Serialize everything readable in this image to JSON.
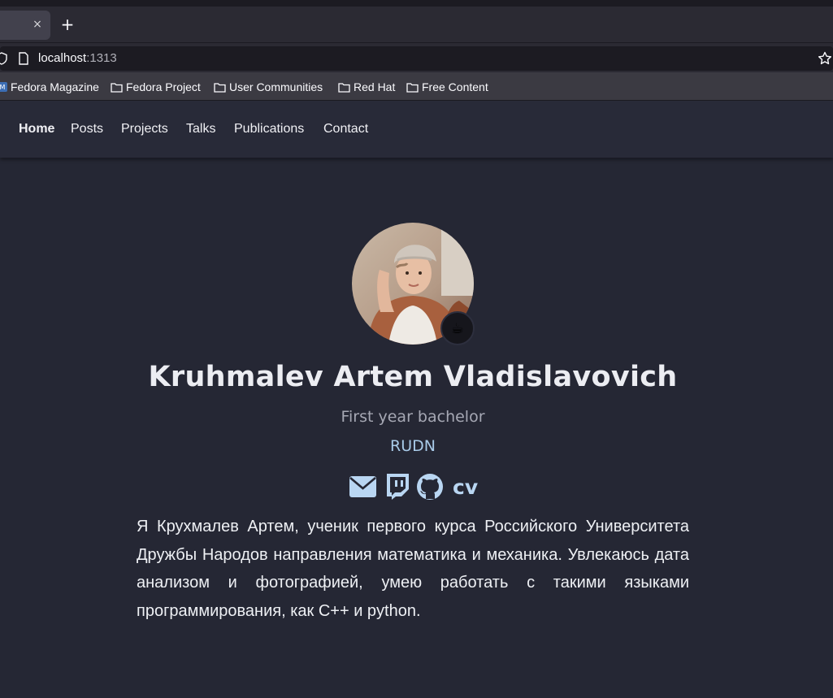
{
  "browser": {
    "tab_close": "×",
    "new_tab": "+",
    "url_host": "localhost",
    "url_port": ":1313",
    "bookmarks": [
      {
        "label": "Fedora Magazine",
        "icon": "fedora-magazine-icon"
      },
      {
        "label": "Fedora Project",
        "icon": "folder-icon"
      },
      {
        "label": "User Communities",
        "icon": "folder-icon"
      },
      {
        "label": "Red Hat",
        "icon": "folder-icon"
      },
      {
        "label": "Free Content",
        "icon": "folder-icon"
      }
    ]
  },
  "site_nav": {
    "items": [
      "Home",
      "Posts",
      "Projects",
      "Talks",
      "Publications",
      "Contact"
    ],
    "active": "Home"
  },
  "profile": {
    "badge_emoji": "☕",
    "name": "Kruhmalev Artem Vladislavovich",
    "role": "First year bachelor",
    "organization": "RUDN",
    "socials": [
      "envelope-icon",
      "twitch-icon",
      "github-icon"
    ],
    "cv_label": "cv",
    "bio": "Я Крухмалев Артем, ученик первого курса Российского Университета Дружбы Народов направления математика и механика. Увлекаюсь дата анализом и фотографией, умею работать с такими языками программирования, как C++ и python."
  },
  "colors": {
    "page_bg": "#252734",
    "nav_bg": "#282a38",
    "accent": "#b9d6f2",
    "text": "#eef0f4"
  }
}
